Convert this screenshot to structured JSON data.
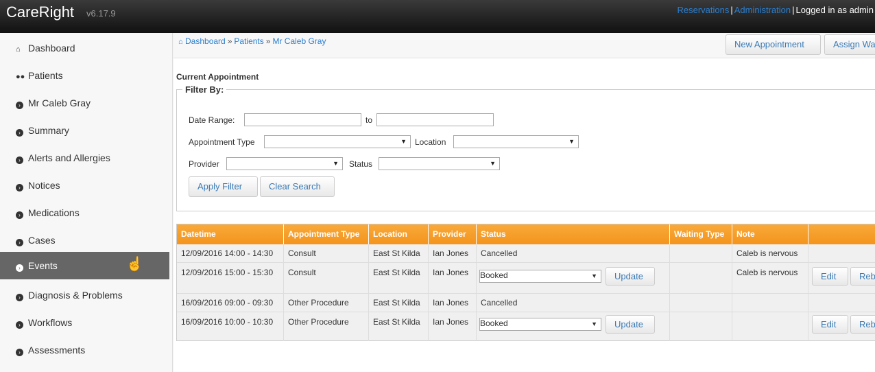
{
  "header": {
    "brand": "CareRight",
    "version": "v6.17.9",
    "links": [
      "Reservations",
      "Administration"
    ],
    "user_text": "Logged in as admin"
  },
  "sidebar": {
    "items": [
      {
        "label": "Dashboard",
        "icon": "home-icon"
      },
      {
        "label": "Patients",
        "icon": "users-icon"
      },
      {
        "label": "Mr Caleb Gray",
        "icon": "chevron-circle-right-icon"
      },
      {
        "label": "Summary",
        "icon": "chevron-circle-right-icon"
      },
      {
        "label": "Alerts and Allergies",
        "icon": "chevron-circle-right-icon"
      },
      {
        "label": "Notices",
        "icon": "chevron-circle-right-icon"
      },
      {
        "label": "Medications",
        "icon": "chevron-circle-right-icon"
      },
      {
        "label": "Cases",
        "icon": "chevron-circle-right-icon"
      },
      {
        "label": "Events",
        "icon": "chevron-circle-right-icon",
        "active": true
      },
      {
        "label": "Diagnosis & Problems",
        "icon": "chevron-circle-right-icon"
      },
      {
        "label": "Workflows",
        "icon": "chevron-circle-right-icon"
      },
      {
        "label": "Assessments",
        "icon": "chevron-circle-right-icon"
      }
    ]
  },
  "breadcrumb": [
    "Dashboard",
    "Patients",
    "Mr Caleb Gray"
  ],
  "actions": {
    "new_appointment": "New Appointment",
    "assign": "Assign Wa"
  },
  "section_title": "Current Appointment",
  "filter": {
    "legend": "Filter By:",
    "date_range_label": "Date Range:",
    "to_label": "to",
    "appointment_type_label": "Appointment Type",
    "location_label": "Location",
    "provider_label": "Provider",
    "status_label": "Status",
    "apply": "Apply Filter",
    "clear": "Clear Search"
  },
  "table": {
    "columns": [
      "Datetime",
      "Appointment Type",
      "Location",
      "Provider",
      "Status",
      "Waiting Type",
      "Note"
    ],
    "rows": [
      {
        "datetime": "12/09/2016 14:00 - 14:30",
        "type": "Consult",
        "location": "East St Kilda",
        "provider": "Ian Jones",
        "status": "Cancelled",
        "note": "Caleb is nervous"
      },
      {
        "datetime": "12/09/2016 15:00 - 15:30",
        "type": "Consult",
        "location": "East St Kilda",
        "provider": "Ian Jones",
        "status": "Booked",
        "note": "Caleb is nervous"
      },
      {
        "datetime": "16/09/2016 09:00 - 09:30",
        "type": "Other Procedure",
        "location": "East St Kilda",
        "provider": "Ian Jones",
        "status": "Cancelled",
        "note": ""
      },
      {
        "datetime": "16/09/2016 10:00 - 10:30",
        "type": "Other Procedure",
        "location": "East St Kilda",
        "provider": "Ian Jones",
        "status": "Booked",
        "note": ""
      }
    ],
    "update": "Update",
    "edit": "Edit",
    "rebook": "Reb"
  },
  "colors": {
    "header_orange": "#f3941d",
    "link_blue": "#2a7fd0",
    "active_nav": "#666666"
  }
}
